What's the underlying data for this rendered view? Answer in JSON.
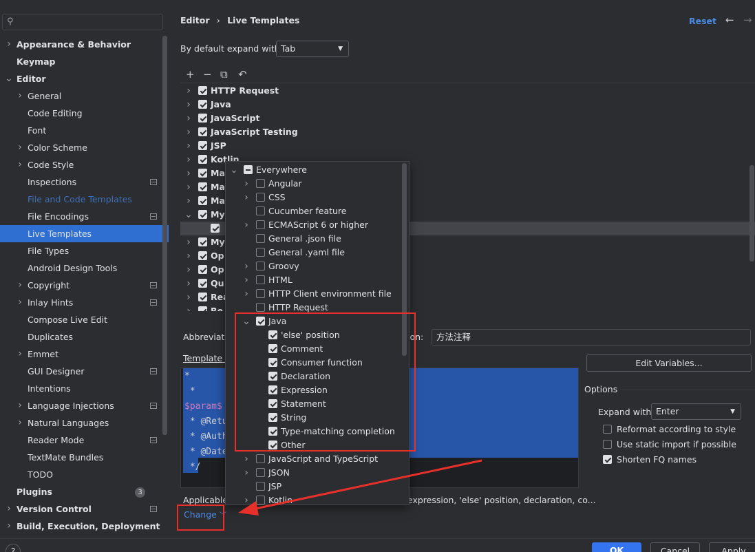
{
  "sidebar": {
    "search_icon": "search-icon",
    "items": [
      {
        "label": "Appearance & Behavior",
        "bold": true,
        "chevron": true,
        "level": 0
      },
      {
        "label": "Keymap",
        "bold": true,
        "chevron": false,
        "level": 0
      },
      {
        "label": "Editor",
        "bold": true,
        "chevron": true,
        "expanded": true,
        "level": 0
      },
      {
        "label": "General",
        "chevron": true,
        "level": 1
      },
      {
        "label": "Code Editing",
        "level": 1
      },
      {
        "label": "Font",
        "level": 1
      },
      {
        "label": "Color Scheme",
        "chevron": true,
        "level": 1
      },
      {
        "label": "Code Style",
        "chevron": true,
        "level": 1
      },
      {
        "label": "Inspections",
        "level": 1,
        "mark": true
      },
      {
        "label": "File and Code Templates",
        "level": 1,
        "dim": true
      },
      {
        "label": "File Encodings",
        "level": 1,
        "mark": true
      },
      {
        "label": "Live Templates",
        "level": 1,
        "selected": true
      },
      {
        "label": "File Types",
        "level": 1
      },
      {
        "label": "Android Design Tools",
        "level": 1
      },
      {
        "label": "Copyright",
        "chevron": true,
        "level": 1,
        "mark": true
      },
      {
        "label": "Inlay Hints",
        "chevron": true,
        "level": 1,
        "mark": true
      },
      {
        "label": "Compose Live Edit",
        "level": 1
      },
      {
        "label": "Duplicates",
        "level": 1
      },
      {
        "label": "Emmet",
        "chevron": true,
        "level": 1
      },
      {
        "label": "GUI Designer",
        "level": 1,
        "mark": true
      },
      {
        "label": "Intentions",
        "level": 1
      },
      {
        "label": "Language Injections",
        "chevron": true,
        "level": 1,
        "mark": true
      },
      {
        "label": "Natural Languages",
        "chevron": true,
        "level": 1
      },
      {
        "label": "Reader Mode",
        "level": 1,
        "mark": true
      },
      {
        "label": "TextMate Bundles",
        "level": 1
      },
      {
        "label": "TODO",
        "level": 1
      },
      {
        "label": "Plugins",
        "bold": true,
        "level": 0,
        "badge": "3"
      },
      {
        "label": "Version Control",
        "bold": true,
        "chevron": true,
        "level": 0,
        "mark": true
      },
      {
        "label": "Build, Execution, Deployment",
        "bold": true,
        "chevron": true,
        "level": 0
      }
    ]
  },
  "header": {
    "breadcrumb_parent": "Editor",
    "breadcrumb_sep": "›",
    "breadcrumb_current": "Live Templates",
    "reset": "Reset",
    "back_icon": "arrow-left-icon",
    "forward_icon": "arrow-right-icon"
  },
  "expand": {
    "label": "By default expand with",
    "value": "Tab"
  },
  "toolbar": {
    "add": "+",
    "remove": "−",
    "copy": "⧉",
    "restore": "↶"
  },
  "template_groups": [
    {
      "label": "HTTP Request",
      "checked": true
    },
    {
      "label": "Java",
      "checked": true
    },
    {
      "label": "JavaScript",
      "checked": true
    },
    {
      "label": "JavaScript Testing",
      "checked": true
    },
    {
      "label": "JSP",
      "checked": true
    },
    {
      "label": "Kotlin",
      "checked": true
    },
    {
      "label": "Ma",
      "checked": true
    },
    {
      "label": "Ma",
      "checked": true
    },
    {
      "label": "Ma",
      "checked": true
    },
    {
      "label": "My",
      "checked": true,
      "expanded": true
    },
    {
      "label": "",
      "checked": true,
      "child": true,
      "highlight": true
    },
    {
      "label": "My",
      "checked": true
    },
    {
      "label": "Op",
      "checked": true
    },
    {
      "label": "Op",
      "checked": true
    },
    {
      "label": "Qu",
      "checked": true
    },
    {
      "label": "Rea",
      "checked": true
    },
    {
      "label": "Re",
      "checked": true
    }
  ],
  "form": {
    "abbreviation_label": "Abbreviati",
    "description_label": "ion:",
    "description_value": "方法注释",
    "template_text_label": "Template t",
    "edit_variables": "Edit Variables...",
    "applicable_label": "Applicable",
    "applicable_rest": "expression, 'else' position, declaration, co...",
    "change_link": "Change"
  },
  "editor_lines": [
    {
      "text": "*",
      "var": false
    },
    {
      "text": " *",
      "var": false
    },
    {
      "text": "$param$",
      "var": true
    },
    {
      "text": " * @Retu",
      "var": false
    },
    {
      "text": " * @Auth",
      "var": false
    },
    {
      "text": " * @Date",
      "var": false
    },
    {
      "text": " */",
      "var": false
    }
  ],
  "options": {
    "title": "Options",
    "expand_with_label": "Expand with",
    "expand_with_value": "Enter",
    "reformat": {
      "label": "Reformat according to style",
      "checked": false
    },
    "static_import": {
      "label": "Use static import if possible",
      "checked": false
    },
    "shorten": {
      "label": "Shorten FQ names",
      "checked": true
    }
  },
  "popup": {
    "items": [
      {
        "label": "Everywhere",
        "state": "ind",
        "chevron": "down",
        "level": 0
      },
      {
        "label": "Angular",
        "state": "off",
        "chevron": "right",
        "level": 1
      },
      {
        "label": "CSS",
        "state": "off",
        "chevron": "right",
        "level": 1
      },
      {
        "label": "Cucumber feature",
        "state": "off",
        "level": 1
      },
      {
        "label": "ECMAScript 6 or higher",
        "state": "off",
        "chevron": "right",
        "level": 1
      },
      {
        "label": "General .json file",
        "state": "off",
        "level": 1
      },
      {
        "label": "General .yaml file",
        "state": "off",
        "level": 1
      },
      {
        "label": "Groovy",
        "state": "off",
        "chevron": "right",
        "level": 1
      },
      {
        "label": "HTML",
        "state": "off",
        "chevron": "right",
        "level": 1
      },
      {
        "label": "HTTP Client environment file",
        "state": "off",
        "chevron": "right",
        "level": 1
      },
      {
        "label": "HTTP Request",
        "state": "off",
        "level": 1
      },
      {
        "label": "Java",
        "state": "on",
        "chevron": "down",
        "level": 1
      },
      {
        "label": "'else' position",
        "state": "on",
        "level": 2
      },
      {
        "label": "Comment",
        "state": "on",
        "level": 2
      },
      {
        "label": "Consumer function",
        "state": "on",
        "level": 2
      },
      {
        "label": "Declaration",
        "state": "on",
        "level": 2
      },
      {
        "label": "Expression",
        "state": "on",
        "level": 2
      },
      {
        "label": "Statement",
        "state": "on",
        "level": 2
      },
      {
        "label": "String",
        "state": "on",
        "level": 2
      },
      {
        "label": "Type-matching completion",
        "state": "on",
        "level": 2
      },
      {
        "label": "Other",
        "state": "on",
        "level": 2
      },
      {
        "label": "JavaScript and TypeScript",
        "state": "off",
        "chevron": "right",
        "level": 1
      },
      {
        "label": "JSON",
        "state": "off",
        "chevron": "right",
        "level": 1
      },
      {
        "label": "JSP",
        "state": "off",
        "level": 1
      },
      {
        "label": "Kotlin",
        "state": "off",
        "chevron": "right",
        "level": 1
      }
    ]
  },
  "dialog": {
    "help": "?",
    "ok": "OK",
    "cancel": "Cancel",
    "apply": "Apply"
  },
  "colors": {
    "accent": "#2e6fd1",
    "link": "#4a8ce8",
    "annotation": "#e8302a",
    "selection": "#2755a8"
  }
}
